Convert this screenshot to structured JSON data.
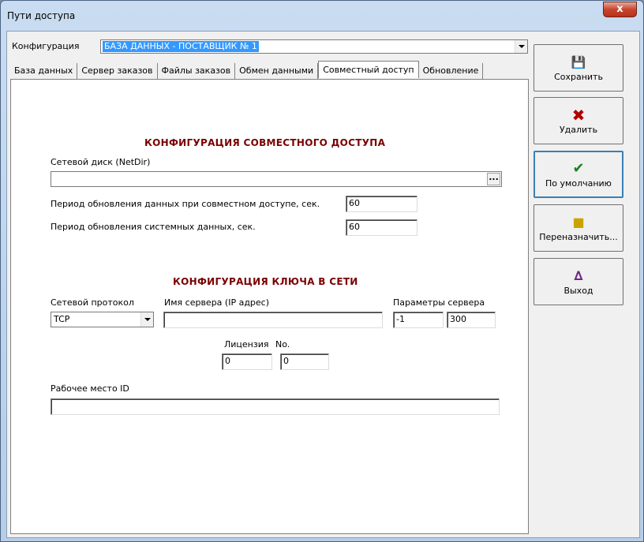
{
  "window": {
    "title": "Пути доступа",
    "close_label": "x"
  },
  "config": {
    "label": "Конфигурация",
    "value": "БАЗА ДАННЫХ - ПОСТАВЩИК № 1"
  },
  "tabs": [
    {
      "label": "База данных"
    },
    {
      "label": "Сервер заказов"
    },
    {
      "label": "Файлы заказов"
    },
    {
      "label": "Обмен данными"
    },
    {
      "label": "Совместный доступ"
    },
    {
      "label": "Обновление"
    }
  ],
  "shared": {
    "heading": "КОНФИГУРАЦИЯ СОВМЕСТНОГО ДОСТУПА",
    "netdir_label": "Сетевой диск (NetDir)",
    "netdir_value": "",
    "browse_label": "...",
    "period_data_label": "Период обновления данных при совместном доступе, сек.",
    "period_data_value": "60",
    "period_sys_label": "Период обновления системных данных, сек.",
    "period_sys_value": "60"
  },
  "key": {
    "heading": "КОНФИГУРАЦИЯ КЛЮЧА В СЕТИ",
    "protocol_label": "Сетевой протокол",
    "protocol_value": "TCP",
    "server_label": "Имя сервера (IP адрес)",
    "server_value": "",
    "params_label": "Параметры сервера",
    "param1_value": "-1",
    "param2_value": "300",
    "license_label": "Лицензия",
    "no_label": "No.",
    "license_value": "0",
    "no_value": "0",
    "workplace_label": "Рабочее место ID",
    "workplace_value": ""
  },
  "buttons": {
    "save": {
      "label": "Сохранить",
      "icon": "floppy-disk-icon"
    },
    "delete": {
      "label": "Удалить",
      "icon": "red-x-icon"
    },
    "default": {
      "label": "По умолчанию",
      "icon": "green-check-icon"
    },
    "reassign": {
      "label": "Переназначить...",
      "icon": "folder-icon"
    },
    "exit": {
      "label": "Выход",
      "icon": "door-exit-icon"
    }
  },
  "colors": {
    "heading": "#7a0000",
    "selection": "#3399ff",
    "close": "#c7452f"
  }
}
